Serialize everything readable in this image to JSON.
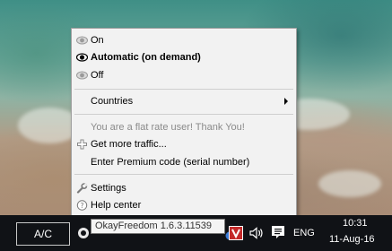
{
  "menu": {
    "items": [
      {
        "label": "On",
        "icon": "eye-icon-grey"
      },
      {
        "label": "Automatic (on demand)",
        "icon": "eye-icon-black"
      },
      {
        "label": "Off",
        "icon": "eye-icon-grey"
      },
      {
        "label": "Countries",
        "icon": "",
        "submenu": true
      },
      {
        "label": "You are a flat rate user! Thank You!",
        "icon": ""
      },
      {
        "label": "Get more traffic...",
        "icon": "plus-icon"
      },
      {
        "label": "Enter Premium code (serial number)",
        "icon": ""
      },
      {
        "label": "Settings",
        "icon": "wrench-icon"
      },
      {
        "label": "Help center",
        "icon": "help-icon"
      }
    ]
  },
  "tooltip": "OkayFreedom 1.6.3.11539",
  "taskbar": {
    "ac_label": "A/C",
    "language": "ENG",
    "time": "10:31",
    "date": "11-Aug-16"
  },
  "colors": {
    "menu_bg": "#f2f2f2",
    "disabled_text": "#8a8a8a",
    "taskbar_bg": "#101216",
    "okayfreedom_red": "#c42a2a"
  }
}
